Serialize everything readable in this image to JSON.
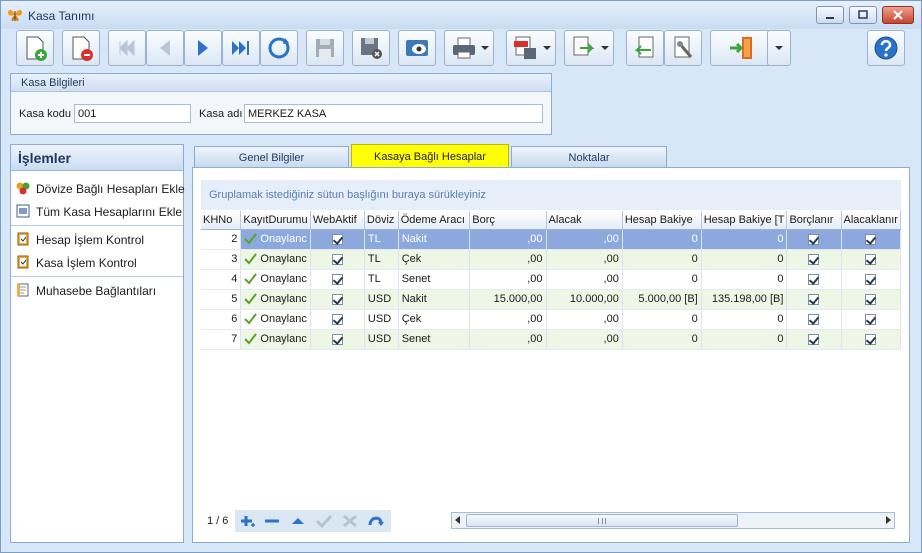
{
  "window": {
    "title": "Kasa Tanımı"
  },
  "toolbar": {
    "icons": [
      "new-document-icon",
      "delete-document-icon",
      "first-record-icon",
      "previous-record-icon",
      "next-record-icon",
      "last-record-icon",
      "refresh-icon",
      "save-icon",
      "cancel-save-icon",
      "preview-icon",
      "print-icon",
      "pdf-export-icon",
      "export-icon",
      "import-icon",
      "tools-icon",
      "exit-icon",
      "help-icon"
    ]
  },
  "kasa_bilgileri": {
    "title": "Kasa Bilgileri",
    "kod_label": "Kasa kodu",
    "kod_value": "001",
    "ad_label": "Kasa adı",
    "ad_value": "MERKEZ KASA"
  },
  "islemler": {
    "title": "İşlemler",
    "items": [
      "Dövize Bağlı Hesapları Ekle",
      "Tüm Kasa Hesaplarını Ekle",
      "Hesap İşlem Kontrol",
      "Kasa İşlem Kontrol",
      "Muhasebe Bağlantıları"
    ]
  },
  "tabs": [
    "Genel Bilgiler",
    "Kasaya Bağlı Hesaplar",
    "Noktalar"
  ],
  "grid": {
    "group_hint": "Gruplamak istediğiniz sütun başlığını buraya sürükleyiniz",
    "columns": [
      "KHNo",
      "KayıtDurumu",
      "WebAktif",
      "Döviz",
      "Ödeme Aracı",
      "Borç",
      "Alacak",
      "Hesap Bakiye",
      "Hesap Bakiye [T",
      "Borçlanır",
      "Alacaklanır"
    ],
    "rows": [
      {
        "khno": "2",
        "durum": "Onaylanc",
        "doviz": "TL",
        "arac": "Nakit",
        "borc": ",00",
        "alacak": ",00",
        "bakiye": "0",
        "bakiye_t": "0"
      },
      {
        "khno": "3",
        "durum": "Onaylanc",
        "doviz": "TL",
        "arac": "Çek",
        "borc": ",00",
        "alacak": ",00",
        "bakiye": "0",
        "bakiye_t": "0"
      },
      {
        "khno": "4",
        "durum": "Onaylanc",
        "doviz": "TL",
        "arac": "Senet",
        "borc": ",00",
        "alacak": ",00",
        "bakiye": "0",
        "bakiye_t": "0"
      },
      {
        "khno": "5",
        "durum": "Onaylanc",
        "doviz": "USD",
        "arac": "Nakit",
        "borc": "15.000,00",
        "alacak": "10.000,00",
        "bakiye": "5.000,00 [B]",
        "bakiye_t": "135.198,00 [B]"
      },
      {
        "khno": "6",
        "durum": "Onaylanc",
        "doviz": "USD",
        "arac": "Çek",
        "borc": ",00",
        "alacak": ",00",
        "bakiye": "0",
        "bakiye_t": "0"
      },
      {
        "khno": "7",
        "durum": "Onaylanc",
        "doviz": "USD",
        "arac": "Senet",
        "borc": ",00",
        "alacak": ",00",
        "bakiye": "0",
        "bakiye_t": "0"
      }
    ],
    "record_count": "1 / 6"
  },
  "colors": {
    "active_tab": "#ffff0a",
    "selected_row": "#8ca8dc",
    "alt_row": "#eef7e6"
  }
}
